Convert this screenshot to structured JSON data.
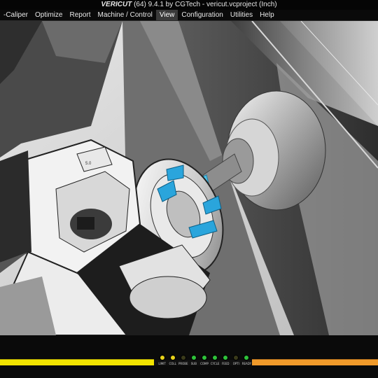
{
  "titlebar": {
    "brand": "VERICUT",
    "text": "(64)  9.4.1 by CGTech - vericut.vcproject (Inch)"
  },
  "menu": {
    "items": [
      {
        "label": "-Caliper",
        "active": false
      },
      {
        "label": "Optimize",
        "active": false
      },
      {
        "label": "Report",
        "active": false
      },
      {
        "label": "Machine / Control",
        "active": false
      },
      {
        "label": "View",
        "active": true
      },
      {
        "label": "Configuration",
        "active": false
      },
      {
        "label": "Utilities",
        "active": false
      },
      {
        "label": "Help",
        "active": false
      }
    ]
  },
  "viewport": {
    "description_icon": "3d-machine-simulation-view",
    "fixture_label": "5.0"
  },
  "status": {
    "progress_colors": {
      "left": "#f2e400",
      "right": "#f09a2a"
    },
    "leds": [
      {
        "label": "LIMIT",
        "color": "#e8d21a"
      },
      {
        "label": "COLL",
        "color": "#e8d21a"
      },
      {
        "label": "PROBE",
        "color": "#3a3a1a"
      },
      {
        "label": "SUB",
        "color": "#2ec23a"
      },
      {
        "label": "COMP",
        "color": "#2ec23a"
      },
      {
        "label": "CYCLE",
        "color": "#2ec23a"
      },
      {
        "label": "FEED",
        "color": "#2ec23a"
      },
      {
        "label": "OPTI",
        "color": "#3a3a1a"
      },
      {
        "label": "READY",
        "color": "#2ec23a"
      }
    ]
  }
}
